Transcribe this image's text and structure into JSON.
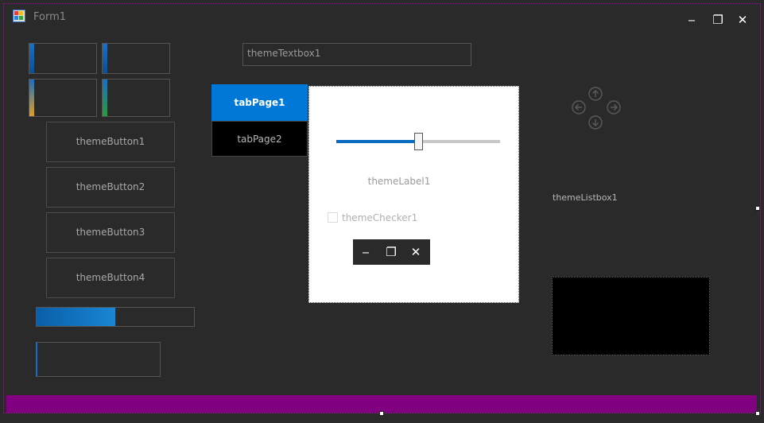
{
  "window": {
    "title": "Form1"
  },
  "title_controls": {
    "minimize": "‒",
    "restore": "❐",
    "close": "✕"
  },
  "tiles": [
    {
      "accent": "#1a6fc4"
    },
    {
      "accent": "#1a6fc4"
    },
    {
      "accent": "#e0a020"
    },
    {
      "accent": "#2a9a3a"
    }
  ],
  "buttons": [
    "themeButton1",
    "themeButton2",
    "themeButton3",
    "themeButton4"
  ],
  "progress": {
    "value_percent": 50
  },
  "textbox": {
    "value": "themeTextbox1"
  },
  "tabs": {
    "page1": "tabPage1",
    "page2": "tabPage2"
  },
  "tab_content": {
    "slider_value_percent": 50,
    "label": "themeLabel1",
    "checkbox_label": "themeChecker1",
    "mini_controls": {
      "minimize": "‒",
      "restore": "❐",
      "close": "✕"
    }
  },
  "listbox": {
    "label": "themeListbox1"
  },
  "colors": {
    "background": "#2a2a2a",
    "accent_blue": "#0078d7",
    "statusbar": "#800080"
  }
}
